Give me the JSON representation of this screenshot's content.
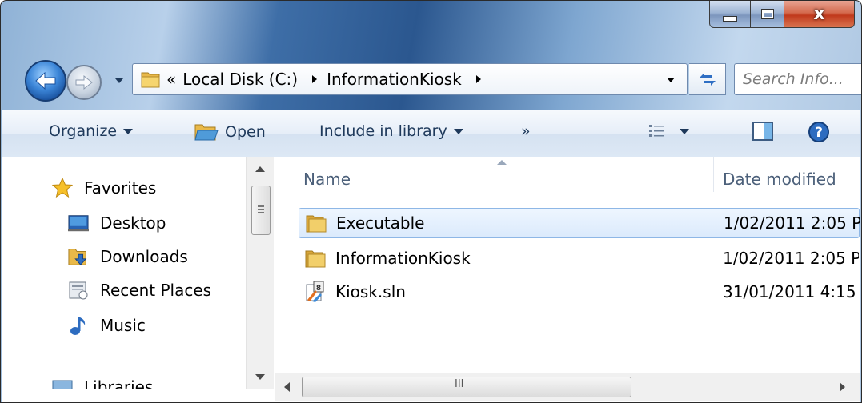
{
  "window": {
    "close_label": "x"
  },
  "nav": {
    "breadcrumb_overflow": "«",
    "breadcrumb": [
      "Local Disk (C:)",
      "InformationKiosk"
    ],
    "search_placeholder": "Search Info..."
  },
  "toolbar": {
    "organize": "Organize",
    "open": "Open",
    "include": "Include in library",
    "more": "»"
  },
  "sidebar": {
    "favorites": "Favorites",
    "items": [
      "Desktop",
      "Downloads",
      "Recent Places",
      "Music"
    ],
    "libraries": "Libraries"
  },
  "columns": {
    "name": "Name",
    "date": "Date modified"
  },
  "files": [
    {
      "name": "Executable",
      "date": "1/02/2011 2:05 P",
      "type": "folder"
    },
    {
      "name": "InformationKiosk",
      "date": "1/02/2011 2:05 P",
      "type": "folder"
    },
    {
      "name": "Kiosk.sln",
      "date": "31/01/2011 4:15",
      "type": "solution"
    }
  ],
  "hscroll_glyph": "III",
  "colors": {
    "toolbar_text": "#1e395b",
    "header_text": "#4c607a",
    "selection_border": "#8eb7e6"
  }
}
